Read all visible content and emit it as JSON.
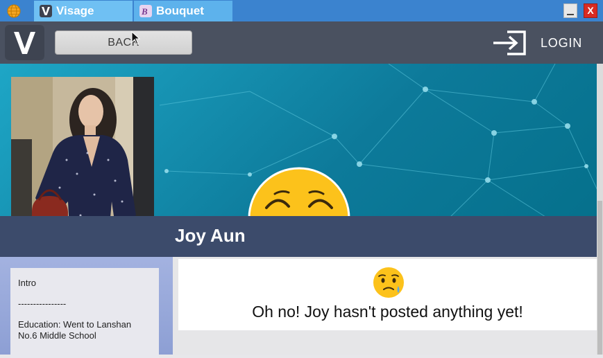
{
  "window": {
    "tabs": [
      {
        "label": "Visage",
        "icon": "visage-v-icon"
      },
      {
        "label": "Bouquet",
        "icon": "bouquet-b-icon"
      }
    ],
    "minimize_label": "_",
    "close_label": "X"
  },
  "header": {
    "logo_letter": "V",
    "back_label": "BACK",
    "login_label": "LOGIN"
  },
  "profile": {
    "name": "Joy Aun",
    "banner_emoji": "pleading-face-emoji"
  },
  "intro": {
    "title": "Intro",
    "divider": "----------------",
    "education": "Education: Went to Lanshan No.6 Middle School"
  },
  "posts": {
    "empty_emoji": "sad-tear-face-emoji",
    "empty_message": "Oh no! Joy hasn't posted anything yet!"
  },
  "colors": {
    "tabbar": "#3b83cf",
    "header": "#4a5160",
    "namebar": "#3c4b6b",
    "banner": "#0d7a9a"
  }
}
